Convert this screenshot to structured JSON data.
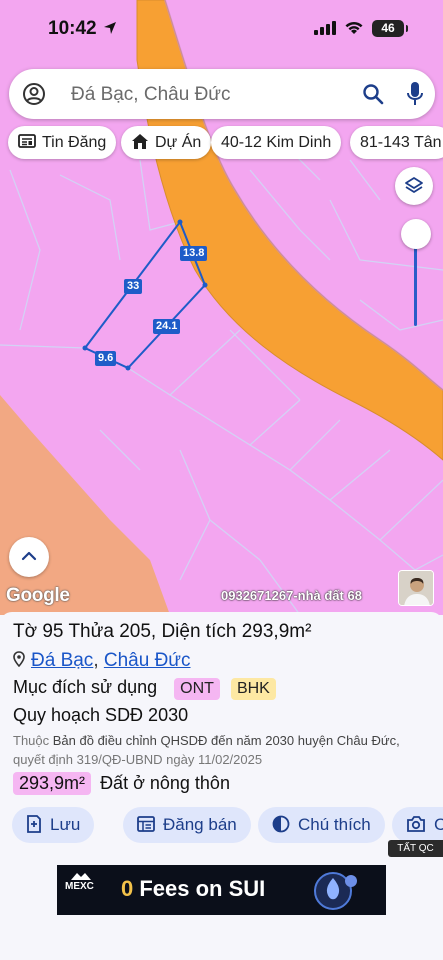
{
  "status_bar": {
    "time": "10:42",
    "battery": "46"
  },
  "search": {
    "placeholder": "Đá Bạc, Châu Đức"
  },
  "chips": [
    {
      "label": "Tin Đăng",
      "icon": "newspaper-icon"
    },
    {
      "label": "Dự Án",
      "icon": "house-icon"
    },
    {
      "label": "40-12 Kim Dinh"
    },
    {
      "label": "81-143 Tân"
    }
  ],
  "map": {
    "plot_dimensions": [
      "13.8",
      "33",
      "24.1",
      "9.6"
    ],
    "watermark": "Google",
    "contact": "0932671267-nhà đất 68",
    "colors": {
      "residential": "#f3a6f0",
      "road": "#f7a033",
      "agri": "#f2a883"
    }
  },
  "parcel": {
    "title_prefix": "Tờ",
    "sheet": "95",
    "plot_label": "Thửa",
    "plot": "205",
    "area_label": ", Diện tích",
    "area": "293,9m²",
    "commune": "Đá Bạc",
    "district": "Châu Đức",
    "purpose_label": "Mục đích sử dụng",
    "purpose_codes": [
      "ONT",
      "BHK"
    ],
    "plan_label": "Quy hoạch SDĐ 2030",
    "desc_prefix": "Thuộc",
    "desc_body": "Bản đồ điều chỉnh QHSDĐ đến năm 2030 huyện Châu Đức,",
    "desc_tail": "quyết định 319/QĐ-UBND ngày 11/02/2025",
    "area_badge": "293,9m²",
    "area_type": "Đất ở nông thôn"
  },
  "actions": [
    {
      "label": "Lưu",
      "icon": "bookmark-add-icon"
    },
    {
      "label": "Đăng bán",
      "icon": "list-icon"
    },
    {
      "label": "Chú thích",
      "icon": "half-circle-icon"
    },
    {
      "label": "C",
      "icon": "camera-icon"
    }
  ],
  "ad_tag": "TẤT QC",
  "ad": {
    "brand": "MEXC",
    "headline_zero": "0",
    "headline_rest": " Fees on SUI"
  }
}
